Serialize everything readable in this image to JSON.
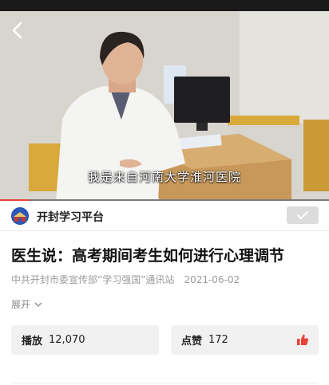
{
  "video": {
    "subtitle": "我是来自河南大学淮河医院",
    "progress_percent": 9
  },
  "channel": {
    "avatar_text": "开封",
    "name": "开封学习平台",
    "follow_icon": "check-icon"
  },
  "article": {
    "title": "医生说：高考期间考生如何进行心理调节",
    "source": "中共开封市委宣传部“学习强国”通讯站",
    "date": "2021-06-02",
    "expand_label": "展开"
  },
  "stats": {
    "plays_label": "播放",
    "plays_value": "12,070",
    "likes_label": "点赞",
    "likes_value": "172",
    "like_icon_color": "#e64336"
  }
}
